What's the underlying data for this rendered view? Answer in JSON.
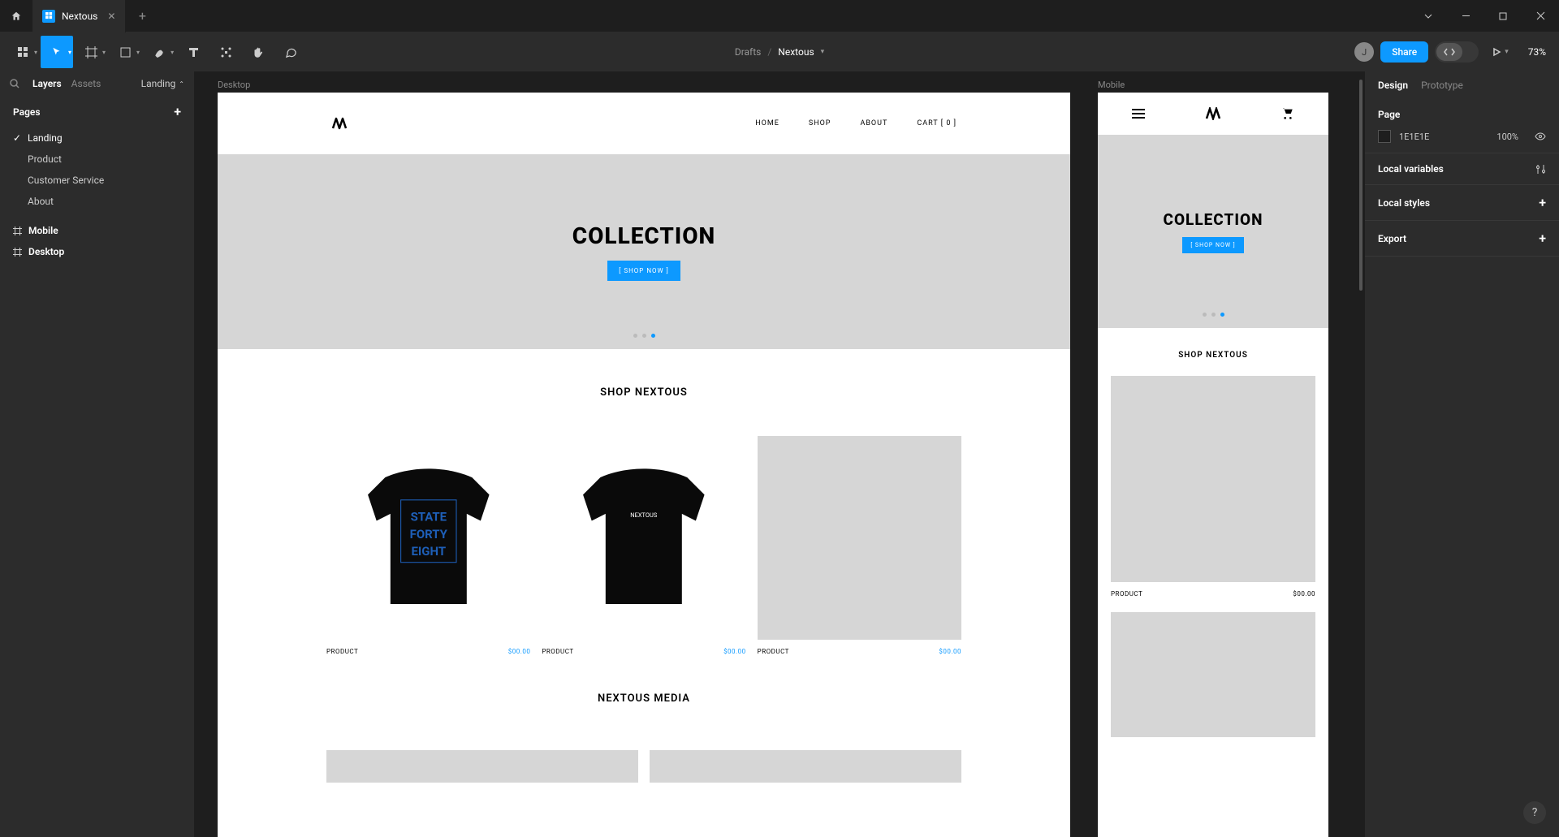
{
  "tab": {
    "title": "Nextous"
  },
  "breadcrumb": {
    "folder": "Drafts",
    "file": "Nextous"
  },
  "toolbar": {
    "share": "Share",
    "zoom": "73%",
    "avatar_initial": "J"
  },
  "leftPanel": {
    "tabs": {
      "layers": "Layers",
      "assets": "Assets"
    },
    "pageDropdown": "Landing",
    "pagesHeader": "Pages",
    "pages": [
      "Landing",
      "Product",
      "Customer Service",
      "About"
    ],
    "frames": [
      "Mobile",
      "Desktop"
    ]
  },
  "canvas": {
    "desktopLabel": "Desktop",
    "mobileLabel": "Mobile",
    "nav": {
      "home": "HOME",
      "shop": "SHOP",
      "about": "ABOUT",
      "cart": "CART [ 0 ]"
    },
    "hero": {
      "title": "COLLECTION",
      "button": "[ SHOP NOW ]"
    },
    "shopSection": "SHOP NEXTOUS",
    "mediaSection": "NEXTOUS MEDIA",
    "product": {
      "name": "PRODUCT",
      "price": "$00.00"
    }
  },
  "rightPanel": {
    "tabs": {
      "design": "Design",
      "prototype": "Prototype"
    },
    "page": {
      "label": "Page",
      "color": "1E1E1E",
      "opacity": "100%"
    },
    "localVariables": "Local variables",
    "localStyles": "Local styles",
    "export": "Export"
  }
}
